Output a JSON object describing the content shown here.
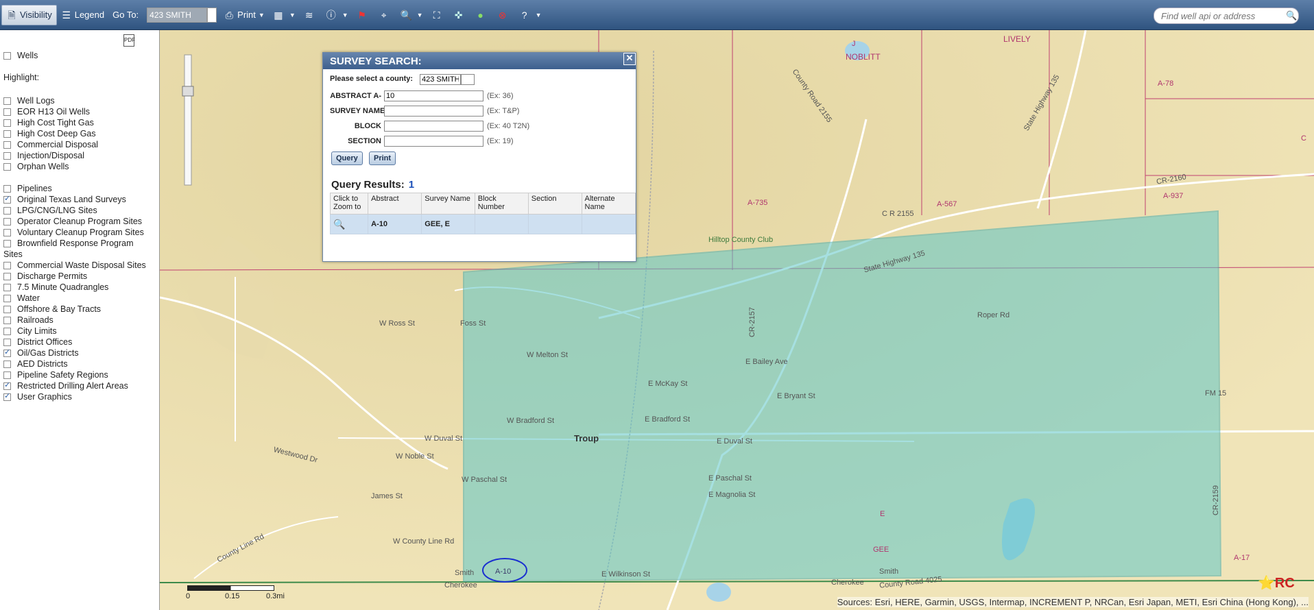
{
  "toolbar": {
    "visibility": "Visibility",
    "legend": "Legend",
    "goto_label": "Go To:",
    "goto_value": "423 SMITH",
    "print": "Print",
    "search_placeholder": "Find well api or address"
  },
  "sidebar": {
    "wells": "Wells",
    "highlight_label": "Highlight:",
    "highlight": [
      "Well Logs",
      "EOR H13 Oil Wells",
      "High Cost Tight Gas",
      "High Cost Deep Gas",
      "Commercial Disposal",
      "Injection/Disposal",
      "Orphan Wells"
    ],
    "layers": [
      {
        "label": "Pipelines",
        "checked": false
      },
      {
        "label": "Original Texas Land Surveys",
        "checked": true
      },
      {
        "label": "LPG/CNG/LNG Sites",
        "checked": false
      },
      {
        "label": "Operator Cleanup Program Sites",
        "checked": false
      },
      {
        "label": "Voluntary Cleanup Program Sites",
        "checked": false
      },
      {
        "label": "Brownfield Response Program",
        "checked": false
      },
      {
        "label": "Commercial Waste Disposal Sites",
        "checked": false
      },
      {
        "label": "Discharge Permits",
        "checked": false
      },
      {
        "label": "7.5 Minute Quadrangles",
        "checked": false
      },
      {
        "label": "Water",
        "checked": false
      },
      {
        "label": "Offshore & Bay Tracts",
        "checked": false
      },
      {
        "label": "Railroads",
        "checked": false
      },
      {
        "label": "City Limits",
        "checked": false
      },
      {
        "label": "District Offices",
        "checked": false
      },
      {
        "label": "Oil/Gas Districts",
        "checked": true
      },
      {
        "label": "AED Districts",
        "checked": false
      },
      {
        "label": "Pipeline Safety Regions",
        "checked": false
      },
      {
        "label": "Restricted Drilling Alert Areas",
        "checked": true
      },
      {
        "label": "User Graphics",
        "checked": true
      }
    ],
    "brownfield_cont": "Sites"
  },
  "dialog": {
    "title": "SURVEY SEARCH:",
    "county_label": "Please select a county:",
    "county_value": "423 SMITH",
    "fields": [
      {
        "label": "ABSTRACT A-",
        "value": "10",
        "example": "(Ex: 36)"
      },
      {
        "label": "SURVEY NAME",
        "value": "",
        "example": "(Ex: T&P)"
      },
      {
        "label": "BLOCK",
        "value": "",
        "example": "(Ex: 40 T2N)"
      },
      {
        "label": "SECTION",
        "value": "",
        "example": "(Ex: 19)"
      }
    ],
    "query_btn": "Query",
    "print_btn": "Print",
    "results_label": "Query Results:",
    "results_count": "1",
    "columns": [
      "Click to Zoom to",
      "Abstract",
      "Survey Name",
      "Block Number",
      "Section",
      "Alternate Name"
    ],
    "rows": [
      {
        "abstract": "A-10",
        "survey": "GEE, E",
        "block": "",
        "section": "",
        "alternate": ""
      }
    ]
  },
  "map": {
    "labels": {
      "lively": "LIVELY",
      "noblitt": "NOBLITT",
      "j": "J",
      "a78": "A-78",
      "c": "C",
      "a735": "A-735",
      "a567": "A-567",
      "a937": "A-937",
      "cr2160": "CR-2160",
      "cr2155": "C R 2155",
      "cr2155b": "County Road 2155",
      "sh135": "State Highway 135",
      "sh135b": "State Highway 135",
      "troup": "Troup",
      "wduval": "W Duval St",
      "eduval": "E Duval St",
      "ebryant": "E Bryant St",
      "eboiley": "E Bailey Ave",
      "wross": "W Ross St",
      "fossst": "Foss St",
      "fm15": "FM 15",
      "cr4025": "County Road 4025",
      "countyline": "County Line Rd",
      "wcountyline": "W County Line Rd",
      "a10": "A-10",
      "gee": "GEE",
      "e": "E",
      "a17": "A-17",
      "smith": "Smith",
      "cherokee": "Cherokee",
      "cherokee2": "Cherokee",
      "smith2": "Smith",
      "hilltop": "Hilltop County Club",
      "roper": "Roper Rd",
      "cr2159": "CR-2159",
      "ewilkinson": "E Wilkinson St",
      "wmelton": "W Melton St",
      "emckay": "E McKay St",
      "ebradford": "E Bradford St",
      "wbradford": "W Bradford St",
      "wnoble": "W Noble St",
      "wpaschal": "W Paschal St",
      "epaschal": "E Paschal St",
      "emagnolia": "E Magnolia St",
      "james": "James St",
      "westwood": "Westwood Dr",
      "cr2157": "CR-2157"
    },
    "scale": [
      "0",
      "0.15",
      "0.3mi"
    ],
    "attribution": "Sources: Esri, HERE, Garmin, USGS, Intermap, INCREMENT P, NRCan, Esri Japan, METI, Esri China (Hong Kong), ..."
  }
}
